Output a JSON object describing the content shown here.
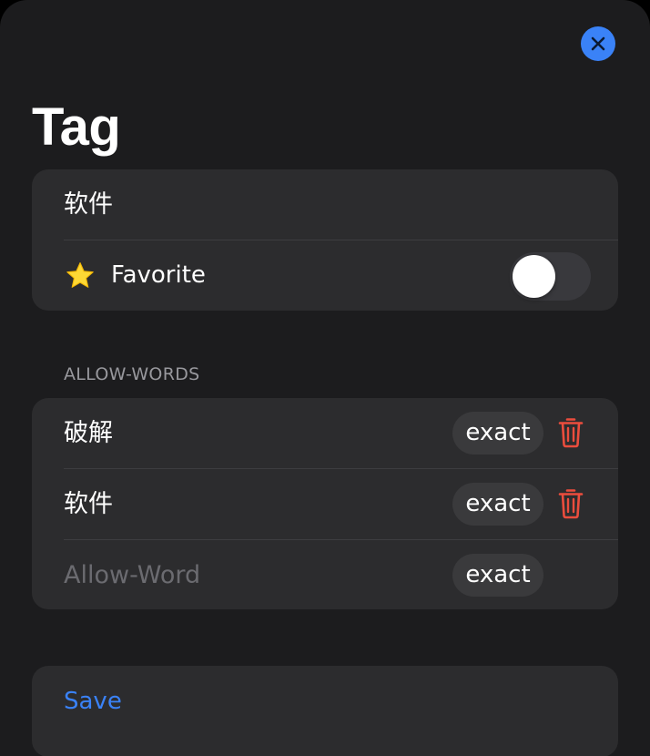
{
  "sheet": {
    "title": "Tag",
    "close_icon": "close-icon"
  },
  "tag_group": {
    "name_value": "软件",
    "favorite_label": "Favorite",
    "favorite_icon": "star-icon",
    "favorite_enabled": false
  },
  "allow_words": {
    "header": "ALLOW-WORDS",
    "items": [
      {
        "word": "破解",
        "match": "exact",
        "delete_icon": "trash-icon"
      },
      {
        "word": "软件",
        "match": "exact",
        "delete_icon": "trash-icon"
      }
    ],
    "new_entry": {
      "placeholder": "Allow-Word",
      "match": "exact"
    }
  },
  "actions": {
    "save_label": "Save"
  },
  "colors": {
    "background": "#1c1c1e",
    "group": "#2c2c2e",
    "accent": "#3a82f7",
    "destructive": "#eb4d3d",
    "star": "#fdd835"
  }
}
